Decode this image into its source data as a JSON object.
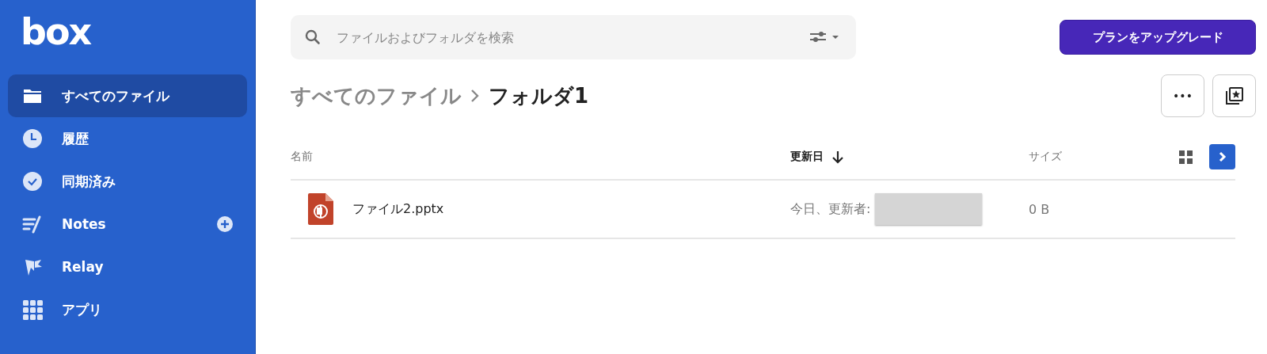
{
  "logo": "box",
  "sidebar": {
    "items": [
      {
        "label": "すべてのファイル",
        "kind": "folder",
        "selected": true
      },
      {
        "label": "履歴",
        "kind": "clock",
        "selected": false
      },
      {
        "label": "同期済み",
        "kind": "check",
        "selected": false
      },
      {
        "label": "Notes",
        "kind": "notes",
        "selected": false,
        "add": true
      },
      {
        "label": "Relay",
        "kind": "relay",
        "selected": false
      },
      {
        "label": "アプリ",
        "kind": "apps",
        "selected": false
      }
    ]
  },
  "search": {
    "placeholder": "ファイルおよびフォルダを検索"
  },
  "upgrade_button": "プランをアップグレード",
  "breadcrumb": [
    {
      "label": "すべてのファイル",
      "current": false
    },
    {
      "label": "フォルダ1",
      "current": true
    }
  ],
  "more_button": "•••",
  "table": {
    "columns": [
      {
        "label": "名前",
        "sorted": false
      },
      {
        "label": "更新日",
        "sorted": true
      },
      {
        "label": "サイズ",
        "sorted": false
      }
    ],
    "rows": [
      {
        "name": "ファイル2.pptx",
        "modified": "今日、更新者:",
        "size": "0 B"
      }
    ]
  }
}
